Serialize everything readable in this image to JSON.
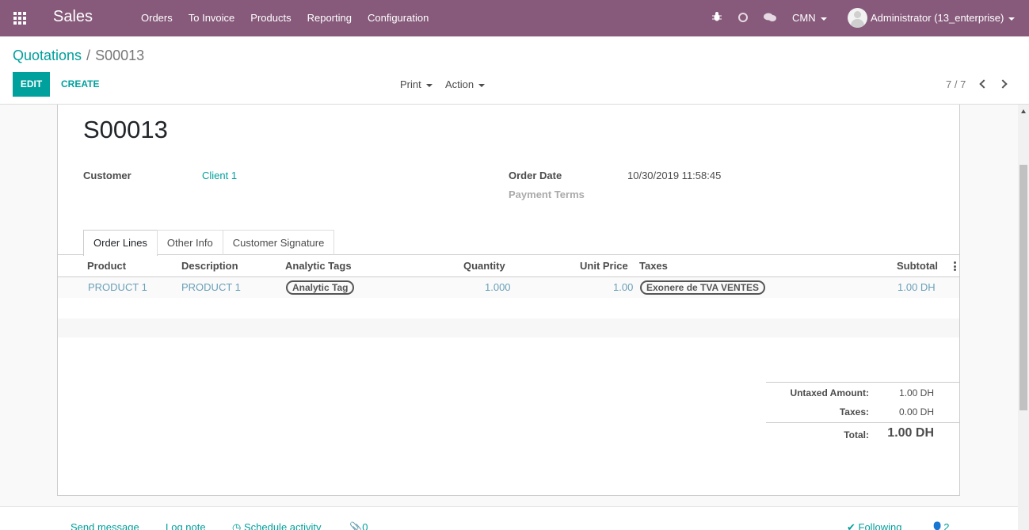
{
  "navbar": {
    "app_name": "Sales",
    "menu": [
      "Orders",
      "To Invoice",
      "Products",
      "Reporting",
      "Configuration"
    ],
    "company": "CMN",
    "user": "Administrator (13_enterprise)",
    "brand_color": "#875a7b"
  },
  "breadcrumb": {
    "parent": "Quotations",
    "separator": "/",
    "current": "S00013"
  },
  "buttons": {
    "edit": "EDIT",
    "create": "CREATE",
    "print": "Print",
    "action": "Action"
  },
  "pager": {
    "value": "7 / 7"
  },
  "form": {
    "name": "S00013",
    "customer_label": "Customer",
    "customer_value": "Client 1",
    "order_date_label": "Order Date",
    "order_date_value": "10/30/2019 11:58:45",
    "payment_terms_label": "Payment Terms"
  },
  "tabs": [
    "Order Lines",
    "Other Info",
    "Customer Signature"
  ],
  "table": {
    "headers": [
      "Product",
      "Description",
      "Analytic Tags",
      "Quantity",
      "Unit Price",
      "Taxes",
      "Subtotal"
    ],
    "rows": [
      {
        "product": "PRODUCT 1",
        "description": "PRODUCT 1",
        "analytic_tag": "Analytic Tag",
        "quantity": "1.000",
        "unit_price": "1.00",
        "tax": "Exonere de TVA VENTES",
        "subtotal": "1.00 DH"
      }
    ]
  },
  "totals": {
    "untaxed_label": "Untaxed Amount:",
    "untaxed_value": "1.00 DH",
    "taxes_label": "Taxes:",
    "taxes_value": "0.00 DH",
    "total_label": "Total:",
    "total_value": "1.00 DH"
  },
  "chatter": {
    "send_message": "Send message",
    "log_note": "Log note",
    "schedule_activity": "Schedule activity",
    "attachments": "0",
    "following": "Following",
    "followers": "2"
  },
  "accent_color": "#00a09d"
}
